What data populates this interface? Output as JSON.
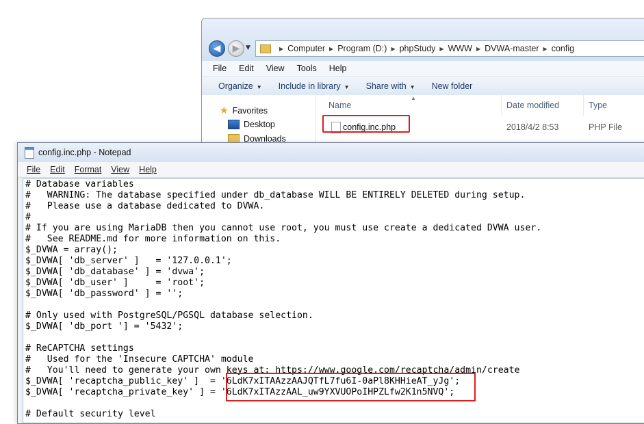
{
  "explorer": {
    "breadcrumb": [
      "Computer",
      "Program (D:)",
      "phpStudy",
      "WWW",
      "DVWA-master",
      "config"
    ],
    "menu": [
      "File",
      "Edit",
      "View",
      "Tools",
      "Help"
    ],
    "toolbar": {
      "organize": "Organize",
      "include": "Include in library",
      "share": "Share with",
      "new_folder": "New folder"
    },
    "nav": {
      "favorites": "Favorites",
      "desktop": "Desktop",
      "downloads": "Downloads"
    },
    "columns": {
      "name": "Name",
      "date": "Date modified",
      "type": "Type"
    },
    "file": {
      "name": "config.inc.php",
      "date": "2018/4/2 8:53",
      "type": "PHP File"
    },
    "highlight_color": "#e01c1c"
  },
  "notepad": {
    "title": "config.inc.php - Notepad",
    "menu": {
      "file": "File",
      "edit": "Edit",
      "format": "Format",
      "view": "View",
      "help": "Help"
    },
    "lines": [
      "# Database variables",
      "#   WARNING: The database specified under db_database WILL BE ENTIRELY DELETED during setup.",
      "#   Please use a database dedicated to DVWA.",
      "#",
      "# If you are using MariaDB then you cannot use root, you must use create a dedicated DVWA user.",
      "#   See README.md for more information on this.",
      "$_DVWA = array();",
      "$_DVWA[ 'db_server' ]   = '127.0.0.1';",
      "$_DVWA[ 'db_database' ] = 'dvwa';",
      "$_DVWA[ 'db_user' ]     = 'root';",
      "$_DVWA[ 'db_password' ] = '';",
      "",
      "# Only used with PostgreSQL/PGSQL database selection.",
      "$_DVWA[ 'db_port '] = '5432';",
      "",
      "# ReCAPTCHA settings",
      "#   Used for the 'Insecure CAPTCHA' module",
      "#   You'll need to generate your own keys at: https://www.google.com/recaptcha/admin/create",
      "$_DVWA[ 'recaptcha_public_key' ]  = '6LdK7xITAAzzAAJQTfL7fu6I-0aPl8KHHieAT_yJg';",
      "$_DVWA[ 'recaptcha_private_key' ] = '6LdK7xITAzzAAL_uw9YXVUOPoIHPZLfw2K1n5NVQ';",
      "",
      "# Default security level"
    ]
  }
}
